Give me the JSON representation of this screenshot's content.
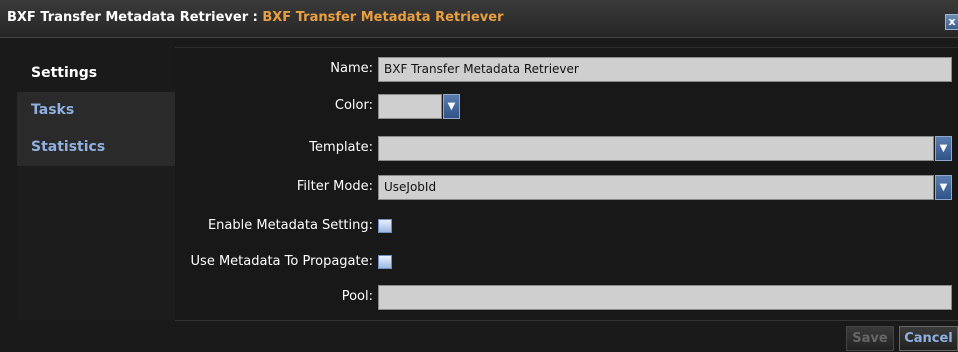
{
  "window": {
    "title_prefix": "BXF Transfer Metadata Retriever : ",
    "title_name": "BXF Transfer Metadata Retriever",
    "close_glyph": "x"
  },
  "sidebar": {
    "items": [
      {
        "label": "Settings"
      },
      {
        "label": "Tasks"
      },
      {
        "label": "Statistics"
      }
    ]
  },
  "form": {
    "name_label": "Name:",
    "name_value": "BXF Transfer Metadata Retriever",
    "color_label": "Color:",
    "template_label": "Template:",
    "template_value": "",
    "filter_label": "Filter Mode:",
    "filter_value": "UseJobId",
    "enable_meta_label": "Enable Metadata Setting:",
    "enable_meta_checked": false,
    "use_meta_label": "Use Metadata To Propagate:",
    "use_meta_checked": false,
    "pool_label": "Pool:",
    "pool_value": ""
  },
  "footer": {
    "save_label": "Save",
    "cancel_label": "Cancel"
  },
  "icons": {
    "dropdown": "chevron-down-icon",
    "close": "close-icon"
  },
  "colors": {
    "accent": "#e8a040",
    "link": "#8fb0e0"
  }
}
